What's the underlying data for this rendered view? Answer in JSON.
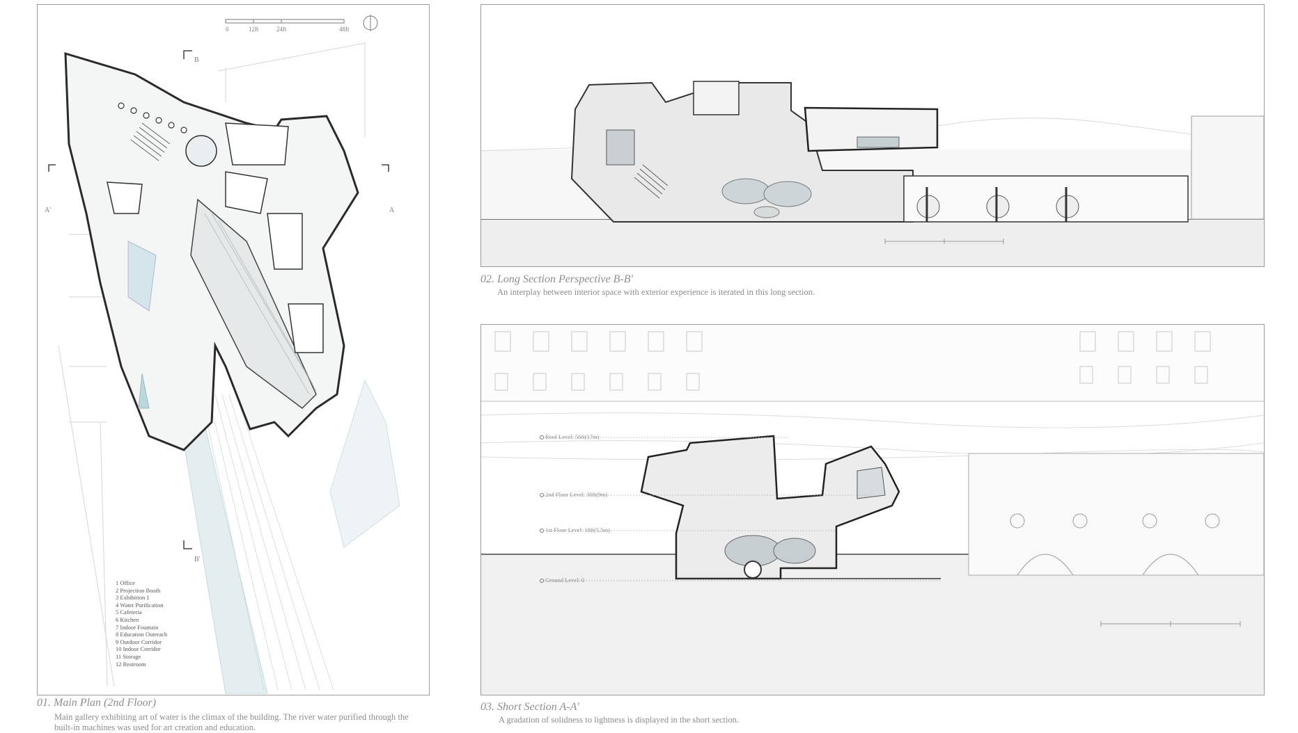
{
  "plan": {
    "scale_labels": [
      "0",
      "12ft",
      "24ft",
      "48ft"
    ],
    "markers": {
      "top": "B",
      "bottom": "B'",
      "left": "A'",
      "right": "A"
    },
    "legend": [
      "1  Office",
      "2  Projection Booth",
      "3  Exhibition 1",
      "4  Water Purification",
      "5  Cafeteria",
      "6  Kitchen",
      "7  Indoor Fountain",
      "8  Education Outreach",
      "9  Outdoor Corridor",
      "10  Indoor Corridor",
      "11  Storage",
      "12  Restroom"
    ],
    "title": "01. Main Plan (2nd Floor)",
    "description": "Main gallery exhibiting art of water is the climax of the building. The river water purified through the",
    "description_line2": "built-in machines was used for art creation and education."
  },
  "long_section": {
    "title": "02. Long Section Perspective B-B'",
    "description": "An interplay between interior space with exterior experience is iterated in this long section."
  },
  "short_section": {
    "title": "03. Short Section A-A'",
    "description": "A gradation of solidness to lightness is displayed in the short section.",
    "levels": [
      "Roof Level: 56ft(17m)",
      "2nd Floor Level: 30ft(9m)",
      "1st Floor Level: 18ft(5.5m)",
      "Ground Level: 0"
    ]
  }
}
